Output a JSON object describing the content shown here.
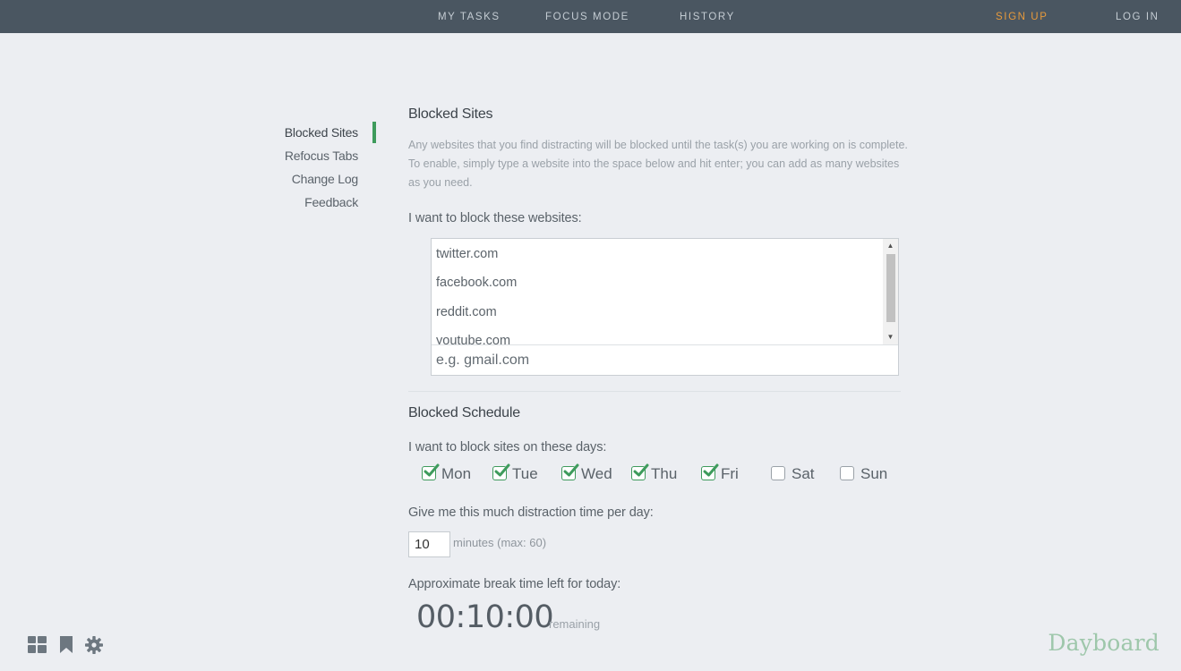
{
  "nav": {
    "my_tasks": "MY TASKS",
    "focus_mode": "FOCUS MODE",
    "history": "HISTORY",
    "sign_up": "SIGN UP",
    "log_in": "LOG IN"
  },
  "sidebar": {
    "items": [
      {
        "label": "Blocked Sites",
        "active": true
      },
      {
        "label": "Refocus Tabs"
      },
      {
        "label": "Change Log"
      },
      {
        "label": "Feedback"
      }
    ]
  },
  "blocked_sites": {
    "title": "Blocked Sites",
    "description": "Any websites that you find distracting will be blocked until the task(s) you are working on is complete. To enable, simply type a website into the space below and hit enter; you can add as many websites as you need.",
    "list_label": "I want to block these websites:",
    "sites": [
      "twitter.com",
      "facebook.com",
      "reddit.com",
      "youtube.com"
    ],
    "input_placeholder": "e.g. gmail.com"
  },
  "schedule": {
    "title": "Blocked Schedule",
    "days_label": "I want to block sites on these days:",
    "days": [
      {
        "label": "Mon",
        "checked": true
      },
      {
        "label": "Tue",
        "checked": true
      },
      {
        "label": "Wed",
        "checked": true
      },
      {
        "label": "Thu",
        "checked": true
      },
      {
        "label": "Fri",
        "checked": true
      },
      {
        "label": "Sat",
        "checked": false
      },
      {
        "label": "Sun",
        "checked": false
      }
    ],
    "distraction_label": "Give me this much distraction time per day:",
    "minutes_value": "10",
    "minutes_suffix": "minutes (max: 60)",
    "break_label": "Approximate break time left for today:",
    "timer": "00:10:00",
    "timer_suffix": "remaining"
  },
  "footer": {
    "icons": [
      "dashboard-icon",
      "bookmark-icon",
      "gear-icon"
    ],
    "brand": "Dayboard"
  },
  "colors": {
    "topbar": "#4a5661",
    "accent_green": "#3e9b5c",
    "signup_orange": "#e79a3c",
    "background": "#eceef2"
  }
}
